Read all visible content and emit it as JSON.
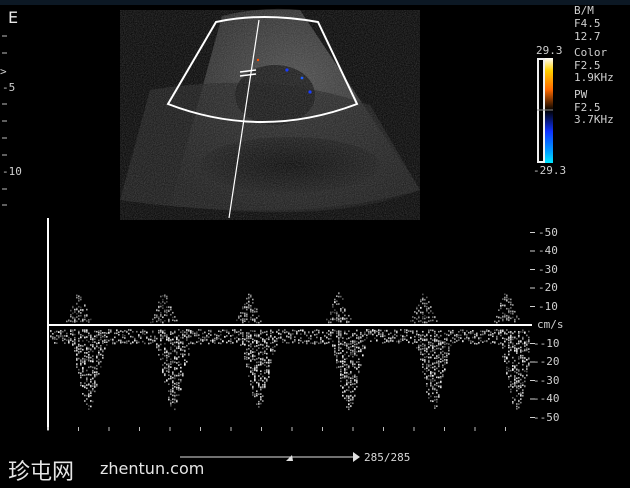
{
  "mode_letter": "E",
  "bm": {
    "title": "B/M",
    "freq": "F4.5",
    "depth": "12.7"
  },
  "color": {
    "title": "Color",
    "freq": "F2.5",
    "prf": "1.9KHz",
    "max": "29.3",
    "min": "-29.3"
  },
  "pw": {
    "title": "PW",
    "freq": "F2.5",
    "prf": "3.7KHz"
  },
  "depth_marks": {
    "arrow": ">",
    "m5": "-5",
    "m10": "-10"
  },
  "doppler_scale": {
    "unit": "cm/s",
    "labels": [
      "-50",
      "-40",
      "-30",
      "-20",
      "-10",
      "--10",
      "--20",
      "--30",
      "--40",
      "--50"
    ],
    "label_values": [
      50,
      40,
      30,
      20,
      10,
      -10,
      -20,
      -30,
      -40,
      -50
    ]
  },
  "cine_counter": "285/285",
  "watermark": {
    "cn": "珍屯网",
    "site": "zhentun.com"
  },
  "colors": {
    "sector_outline": "#ffffff",
    "color_bar_top": "#ffd000",
    "color_bar_bottom": "#00e0ff"
  }
}
